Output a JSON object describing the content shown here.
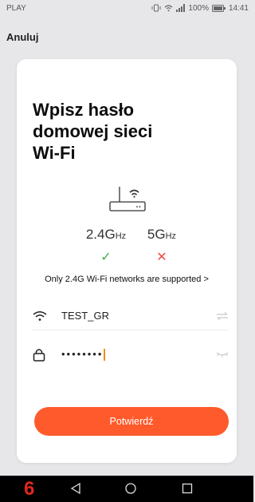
{
  "status": {
    "carrier": "PLAY",
    "battery": "100%",
    "time": "14:41"
  },
  "header": {
    "cancel_label": "Anuluj"
  },
  "card": {
    "title_line1": "Wpisz hasło",
    "title_line2": "domowej sieci",
    "title_line3": "Wi-Fi",
    "band_24_main": "2.4G",
    "band_24_unit": "Hz",
    "band_5_main": "5G",
    "band_5_unit": "Hz",
    "band_24_mark": "✓",
    "band_5_mark": "✕",
    "supported_text": "Only 2.4G Wi-Fi networks are supported",
    "supported_chevron": ">",
    "ssid_value": "TEST_GR",
    "password_value": "••••••••",
    "confirm_label": "Potwierdź"
  },
  "navbar": {
    "digit": "6"
  },
  "colors": {
    "accent": "#ff5a2b",
    "ok": "#3cb34a",
    "error": "#ee4c44",
    "background": "#e7e7ea",
    "caret": "#f28c1a"
  },
  "icons": {
    "router": "router-icon",
    "wifi": "wifi-icon",
    "lock": "lock-icon",
    "switch": "switch-network-icon",
    "eye": "eye-closed-icon"
  }
}
